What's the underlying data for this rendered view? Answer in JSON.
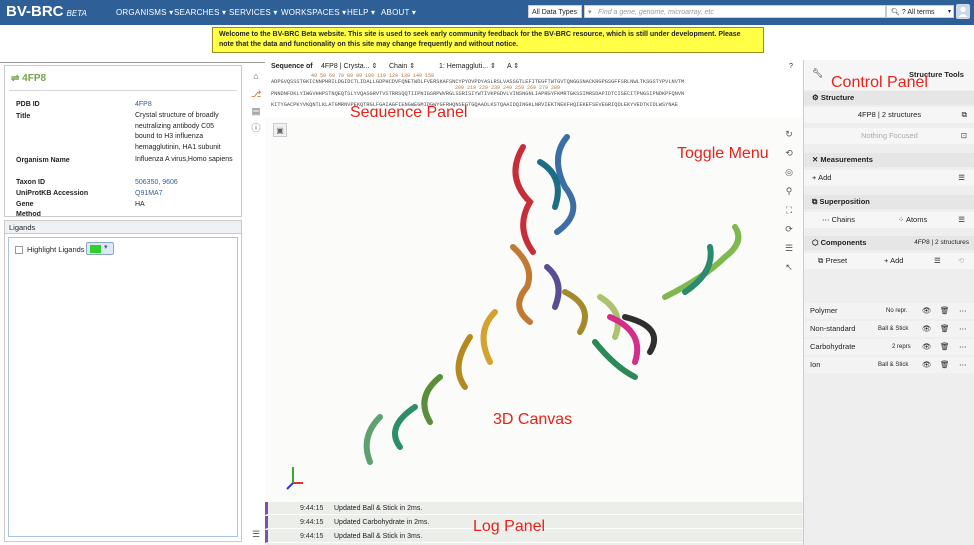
{
  "topnav": {
    "brand": "BV-BRC",
    "brand_tag": "BETA",
    "menu": [
      "ORGANISMS",
      "SEARCHES",
      "SERVICES",
      "WORKSPACES",
      "HELP",
      "ABOUT"
    ],
    "data_type": "All Data Types",
    "search_placeholder": "Find a gene, genome, microarray, etc",
    "search_scope": "All terms"
  },
  "banner": "Welcome to the BV-BRC Beta website. This site is used to seek early community feedback for the BV-BRC resource, which is still under development. Please note that the data and functionality on this site may change frequently and without notice.",
  "protein": {
    "title": "4FP8",
    "fields": [
      {
        "label": "PDB ID",
        "value": "4FP8"
      },
      {
        "label": "Title",
        "value": "Crystal structure of broadly neutralizing antibody C05 bound to H3 influenza hemagglutinin, HA1 subunit"
      },
      {
        "label": "Organism Name",
        "value": "Influenza A virus,Homo sapiens"
      },
      {
        "label": "Taxon ID",
        "value": "506350, 9606"
      },
      {
        "label": "UniProtKB Accession",
        "value": "Q91MA7"
      },
      {
        "label": "Gene",
        "value": "HA"
      },
      {
        "label": "Method",
        "value": ""
      }
    ]
  },
  "ligands": {
    "header": "Ligands",
    "highlight_label": "Highlight Ligands",
    "swatch_color": "#2fd12f"
  },
  "sequence": {
    "label": "Sequence of",
    "structure": "4FP8 | Crysta...",
    "mode": "Chain",
    "chain": "1: Hemaggluti...",
    "entity": "A",
    "line1": "ADPGVQSSSTGKICNNPHRILDGIDCTLIDALLGDPHCDVFQNETWDLFVERSKAFSNCYPYDVPDYASLRSLVASSGTLEFITEGFTWTGVTQNGGSNACKRGPGSGFFSRLNWLTKSGSTYPVLNVTM",
    "line2": "PNNDNFDKLYIWGVHHPSTNQEQTSLYVQASGRVTVSTRRSQQTIIPNIGSRPWVRGLSSRISIYWTIVKPGDVLVINSNGNLIAPRGYFKMRTGKSSIMRSDAPIDTCISECITPNGSIPNDKPFQNVN",
    "line3": "KITYGACPKYVKQNTLKLATGMRNVPEKQTRGLFGAIAGFIENGWEGMIDGWYGFRHQNSEGTGQAADLKSTQAAIDQINGKLNRVIEKTNEKFHQIEKEFSEVEGRIQDLEKYVEDTKIDLWSYNAE",
    "nums1": "49        59        69        79        89        99        109       119       129       139       149       159",
    "nums2": "209       219       229       239       249       259       269       279       289"
  },
  "log": [
    {
      "time": "9:44:15",
      "message": "Updated Ball & Stick in 2ms."
    },
    {
      "time": "9:44:15",
      "message": "Updated Carbohydrate in 2ms."
    },
    {
      "time": "9:44:15",
      "message": "Updated Ball & Stick in 3ms."
    }
  ],
  "right": {
    "tools_title": "Structure Tools",
    "structure_header": "Structure",
    "structure_value": "4FP8 | 2 structures",
    "focus": "Nothing Focused",
    "measurements_header": "Measurements",
    "add": "Add",
    "superposition_header": "Superposition",
    "chains": "Chains",
    "atoms": "Atoms",
    "components_header": "Components",
    "components_count": "4FP8 | 2 structures",
    "preset": "Preset",
    "add2": "Add",
    "components": [
      {
        "name": "Polymer",
        "repr": "No repr."
      },
      {
        "name": "Non-standard",
        "repr": "Ball & Stick"
      },
      {
        "name": "Carbohydrate",
        "repr": "2 reprs"
      },
      {
        "name": "Ion",
        "repr": "Ball & Stick"
      }
    ]
  },
  "annotations": {
    "control": "Control Panel",
    "sequence": "Sequence Panel",
    "toggle": "Toggle Menu",
    "canvas": "3D Canvas",
    "log": "Log Panel"
  },
  "colors": {
    "nav": "#2e5f97",
    "banner": "#ffff45",
    "annotation": "#e8221a",
    "title_green": "#77a54b"
  }
}
